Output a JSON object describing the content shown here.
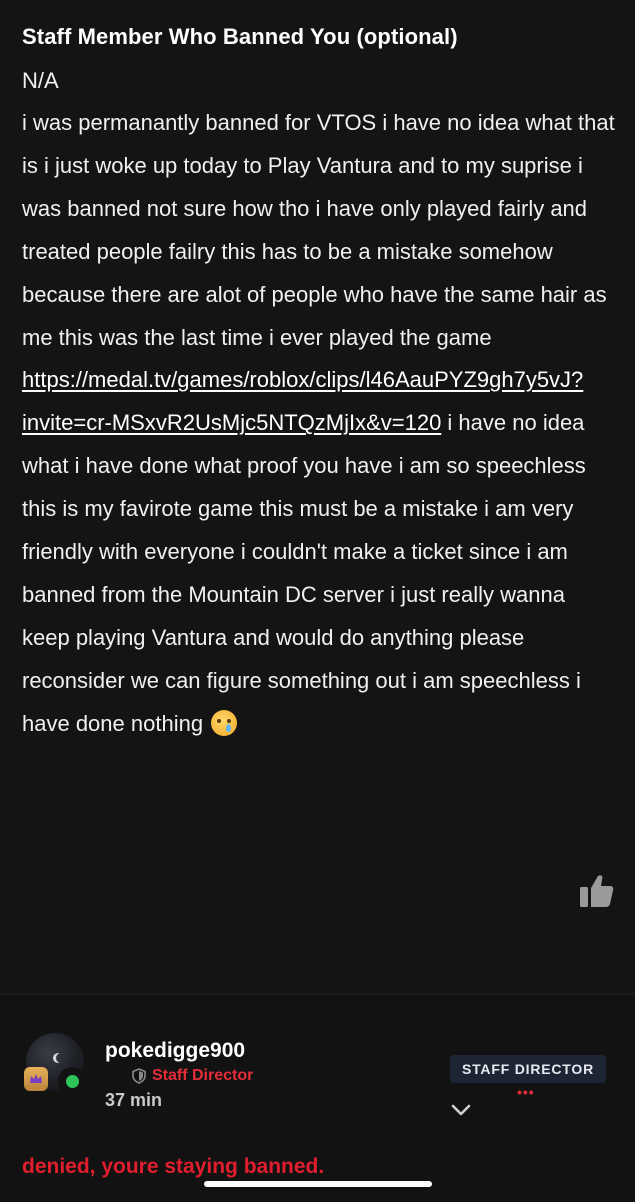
{
  "post": {
    "field_label": "Staff Member Who Banned You (optional)",
    "field_value": "N/A",
    "body_part1": "i was permanantly banned for VTOS i have no idea what that is i just woke up today to Play Vantura and to my suprise i was banned not sure how tho i have only played fairly and treated people failry this has to be a mistake somehow because there are alot of people who have the same hair as me this was the last time i ever played the game ",
    "link": "https://medal.tv/games/roblox/clips/l46AauPYZ9gh7y5vJ?invite=cr-MSxvR2UsMjc5NTQzMjIx&v=120",
    "body_part2": " i have no idea what i have done what proof you have i am so speechless this is my favirote game this must be a mistake i am very friendly with everyone i couldn't make a ticket since i am banned from the Mountain DC server i just really wanna keep playing Vantura and would do anything please reconsider we can figure something out i am speechless i have done nothing ",
    "emoji": "crying-face",
    "like_icon": "thumbs-up-icon"
  },
  "reply": {
    "username": "pokedigge900",
    "role": "Staff Director",
    "time": "37 min",
    "badge": "STAFF DIRECTOR",
    "more": "•••",
    "text": "denied, youre staying banned.",
    "role_color": "#e52d3a",
    "online_color": "#2fc45a"
  }
}
